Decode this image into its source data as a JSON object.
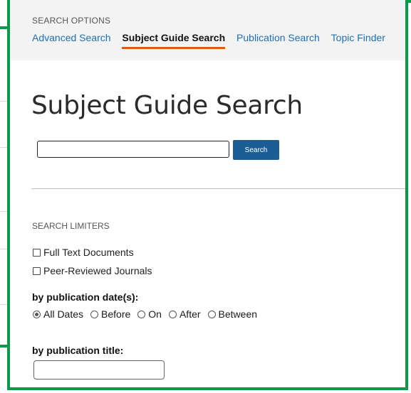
{
  "search_options": {
    "label": "SEARCH OPTIONS",
    "links": [
      {
        "label": "Advanced Search",
        "active": false
      },
      {
        "label": "Subject Guide Search",
        "active": true
      },
      {
        "label": "Publication Search",
        "active": false
      },
      {
        "label": "Topic Finder",
        "active": false
      }
    ]
  },
  "main": {
    "title": "Subject Guide Search",
    "search_input_value": "",
    "search_button_label": "Search"
  },
  "limiters": {
    "label": "SEARCH LIMITERS",
    "checkboxes": [
      {
        "label": "Full Text Documents",
        "checked": false
      },
      {
        "label": "Peer-Reviewed Journals",
        "checked": false
      }
    ],
    "date_heading": "by publication date(s):",
    "date_options": [
      {
        "label": "All Dates",
        "selected": true
      },
      {
        "label": "Before",
        "selected": false
      },
      {
        "label": "On",
        "selected": false
      },
      {
        "label": "After",
        "selected": false
      },
      {
        "label": "Between",
        "selected": false
      }
    ],
    "title_heading": "by publication title:",
    "title_input_value": ""
  },
  "colors": {
    "highlight_frame": "#0a9a4a",
    "link": "#1f6fb2",
    "active_underline": "#e05a1c",
    "button": "#1b5e96"
  }
}
